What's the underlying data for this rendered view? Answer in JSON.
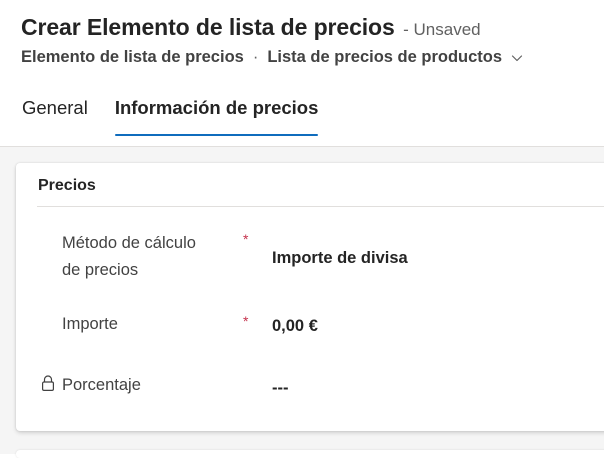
{
  "header": {
    "title": "Crear Elemento de lista de precios",
    "status": "- Unsaved",
    "entity_name": "Elemento de lista de precios",
    "separator": "·",
    "form_name": "Lista de precios de productos"
  },
  "tabs": [
    {
      "label": "General",
      "selected": false
    },
    {
      "label": "Información de precios",
      "selected": true
    }
  ],
  "section": {
    "title": "Precios",
    "fields": [
      {
        "label_line1": "Método de cálculo",
        "label_line2": "de precios",
        "required": true,
        "required_mark": "*",
        "value": "Importe de divisa"
      },
      {
        "label": "Importe",
        "required": true,
        "required_mark": "*",
        "value": "0,00 €"
      },
      {
        "label": "Porcentaje",
        "locked": true,
        "value": "---"
      }
    ]
  },
  "colors": {
    "accent": "#0f6cbd",
    "required": "#c4314b",
    "canvas": "#f5f5f5"
  },
  "icons": {
    "form_selector": "chevron-down-icon",
    "locked_field": "lock-icon"
  }
}
